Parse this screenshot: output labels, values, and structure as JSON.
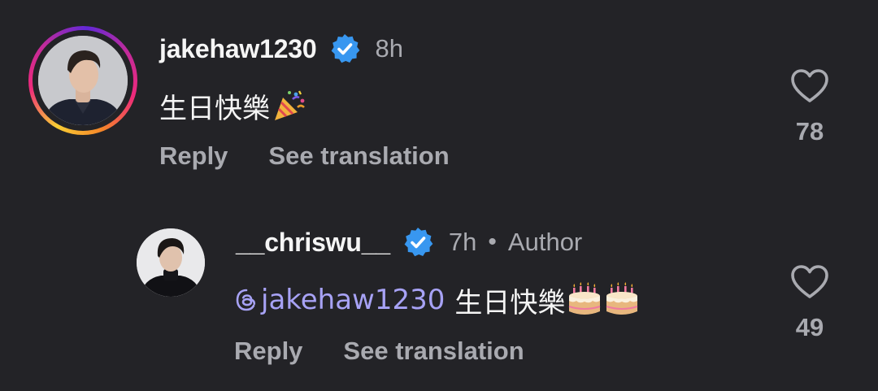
{
  "comments": [
    {
      "username": "jakehaw1230",
      "verified": true,
      "time": "8h",
      "text": "生日快樂",
      "emoji": "party-popper",
      "actions": {
        "reply": "Reply",
        "translate": "See translation"
      },
      "likes": "78",
      "has_story_ring": true
    },
    {
      "username": "__chriswu__",
      "verified": true,
      "time": "7h",
      "separator": "•",
      "badge": "Author",
      "mention": "jakehaw1230",
      "text": "生日快樂",
      "emoji": "birthday-cake",
      "actions": {
        "reply": "Reply",
        "translate": "See translation"
      },
      "likes": "49"
    }
  ],
  "colors": {
    "background": "#232327",
    "primary_text": "#f5f5f5",
    "secondary_text": "#a9aab0",
    "verified_blue": "#3897f0",
    "mention": "#a7a2f5"
  }
}
